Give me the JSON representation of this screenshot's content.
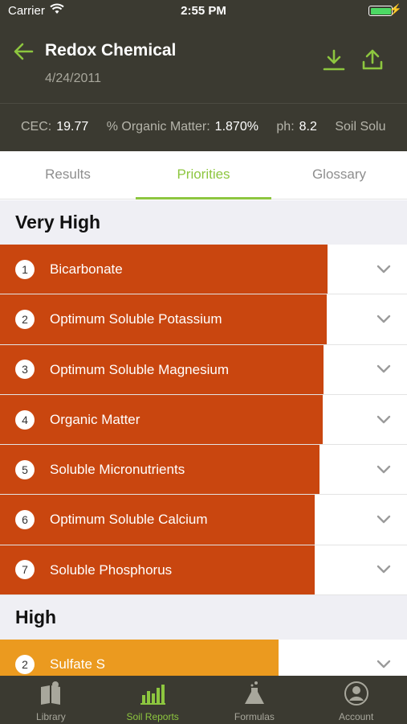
{
  "status_bar": {
    "carrier": "Carrier",
    "time": "2:55 PM"
  },
  "header": {
    "title": "Redox Chemical",
    "date": "4/24/2011"
  },
  "metrics": [
    {
      "label": "CEC:",
      "value": "19.77"
    },
    {
      "label": "% Organic Matter:",
      "value": "1.870%"
    },
    {
      "label": "ph:",
      "value": "8.2"
    },
    {
      "label": "Soil Solu",
      "value": ""
    }
  ],
  "tabs": [
    {
      "label": "Results",
      "active": false
    },
    {
      "label": "Priorities",
      "active": true
    },
    {
      "label": "Glossary",
      "active": false
    }
  ],
  "colors": {
    "very_high": "#c9460f",
    "high": "#eb9a1f",
    "accent": "#8dc63f",
    "header_bg": "#3b3a31"
  },
  "priorities": {
    "very_high": {
      "heading": "Very High",
      "items": [
        {
          "rank": "1",
          "label": "Bicarbonate",
          "level": 0.805
        },
        {
          "rank": "2",
          "label": "Optimum Soluble Potassium",
          "level": 0.803
        },
        {
          "rank": "3",
          "label": "Optimum Soluble Magnesium",
          "level": 0.795
        },
        {
          "rank": "4",
          "label": "Organic Matter",
          "level": 0.793
        },
        {
          "rank": "5",
          "label": "Soluble Micronutrients",
          "level": 0.785
        },
        {
          "rank": "6",
          "label": "Optimum Soluble Calcium",
          "level": 0.773
        },
        {
          "rank": "7",
          "label": "Soluble Phosphorus",
          "level": 0.773
        }
      ]
    },
    "high": {
      "heading": "High",
      "items": [
        {
          "rank": "2",
          "label": "Sulfate S",
          "level": 0.685
        }
      ]
    }
  },
  "bottom_nav": [
    {
      "label": "Library",
      "icon": "book-icon",
      "active": false
    },
    {
      "label": "Soil Reports",
      "icon": "bar-chart-icon",
      "active": true
    },
    {
      "label": "Formulas",
      "icon": "flask-icon",
      "active": false
    },
    {
      "label": "Account",
      "icon": "account-icon",
      "active": false
    }
  ]
}
